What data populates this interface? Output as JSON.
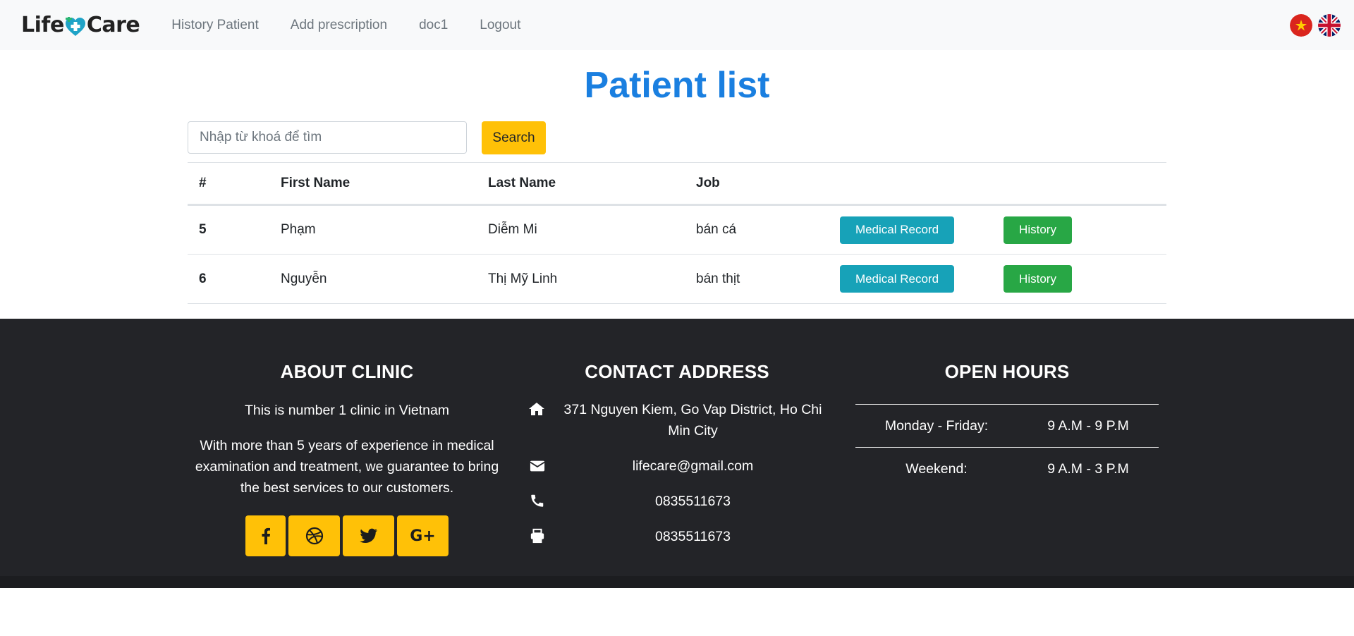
{
  "navbar": {
    "brand_left": "Life",
    "brand_right": "Care",
    "links": [
      "History Patient",
      "Add prescription",
      "doc1",
      "Logout"
    ],
    "flags": [
      "vietnam-flag-icon",
      "uk-flag-icon"
    ]
  },
  "page": {
    "title": "Patient list",
    "search_placeholder": "Nhập từ khoá để tìm",
    "search_label": "Search"
  },
  "table": {
    "headers": [
      "#",
      "First Name",
      "Last Name",
      "Job"
    ],
    "rows": [
      {
        "id": "5",
        "first": "Phạm",
        "last": "Diễm Mi",
        "job": "bán cá"
      },
      {
        "id": "6",
        "first": "Nguyễn",
        "last": "Thị Mỹ Linh",
        "job": "bán thịt"
      }
    ],
    "record_label": "Medical Record",
    "history_label": "History"
  },
  "footer": {
    "about": {
      "title": "ABOUT CLINIC",
      "line1": "This is number 1 clinic in Vietnam",
      "line2": "With more than 5 years of experience in medical examination and treatment, we guarantee to bring the best services to our customers.",
      "socials": [
        "facebook-icon",
        "dribbble-icon",
        "twitter-icon",
        "google-plus-icon"
      ]
    },
    "contact": {
      "title": "CONTACT ADDRESS",
      "address": "371 Nguyen Kiem, Go Vap District, Ho Chi Min City",
      "email": "lifecare@gmail.com",
      "phone": "0835511673",
      "fax": "0835511673"
    },
    "hours": {
      "title": "OPEN HOURS",
      "rows": [
        {
          "day": "Monday - Friday:",
          "time": "9 A.M - 9 P.M"
        },
        {
          "day": "Weekend:",
          "time": "9 A.M - 3 P.M"
        }
      ]
    }
  },
  "colors": {
    "title": "#1a7fe0",
    "search_button": "#ffc107",
    "record_button": "#17a2b8",
    "history_button": "#28a745",
    "footer_bg": "#232428"
  }
}
